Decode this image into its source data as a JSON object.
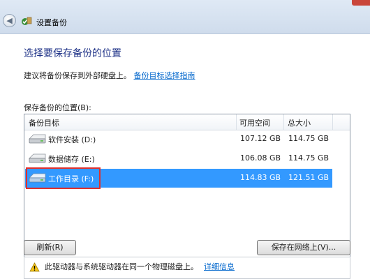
{
  "window": {
    "title": "设置备份"
  },
  "page": {
    "heading": "选择要保存备份的位置",
    "hint_text": "建议将备份保存到外部硬盘上。",
    "hint_link": "备份目标选择指南",
    "list_label": "保存备份的位置(B):"
  },
  "table": {
    "columns": [
      "备份目标",
      "可用空间",
      "总大小"
    ],
    "rows": [
      {
        "name": "软件安装 (D:)",
        "free": "107.12 GB",
        "total": "114.75 GB",
        "selected": false
      },
      {
        "name": "数据储存 (E:)",
        "free": "106.08 GB",
        "total": "114.75 GB",
        "selected": false
      },
      {
        "name": "工作目录 (F:)",
        "free": "114.83 GB",
        "total": "121.51 GB",
        "selected": true
      }
    ]
  },
  "buttons": {
    "refresh": "刷新(R)",
    "save_network": "保存在网络上(V)..."
  },
  "warning": {
    "text": "此驱动器与系统驱动器在同一个物理磁盘上。",
    "link": "详细信息"
  },
  "icons": {
    "back": "back-arrow-icon",
    "app": "backup-app-icon",
    "drive": "hard-drive-icon",
    "warning": "warning-triangle-icon"
  },
  "colors": {
    "selection": "#3399ff",
    "highlight_box": "#e0302c",
    "heading": "#1e3287",
    "link": "#0066cc"
  }
}
